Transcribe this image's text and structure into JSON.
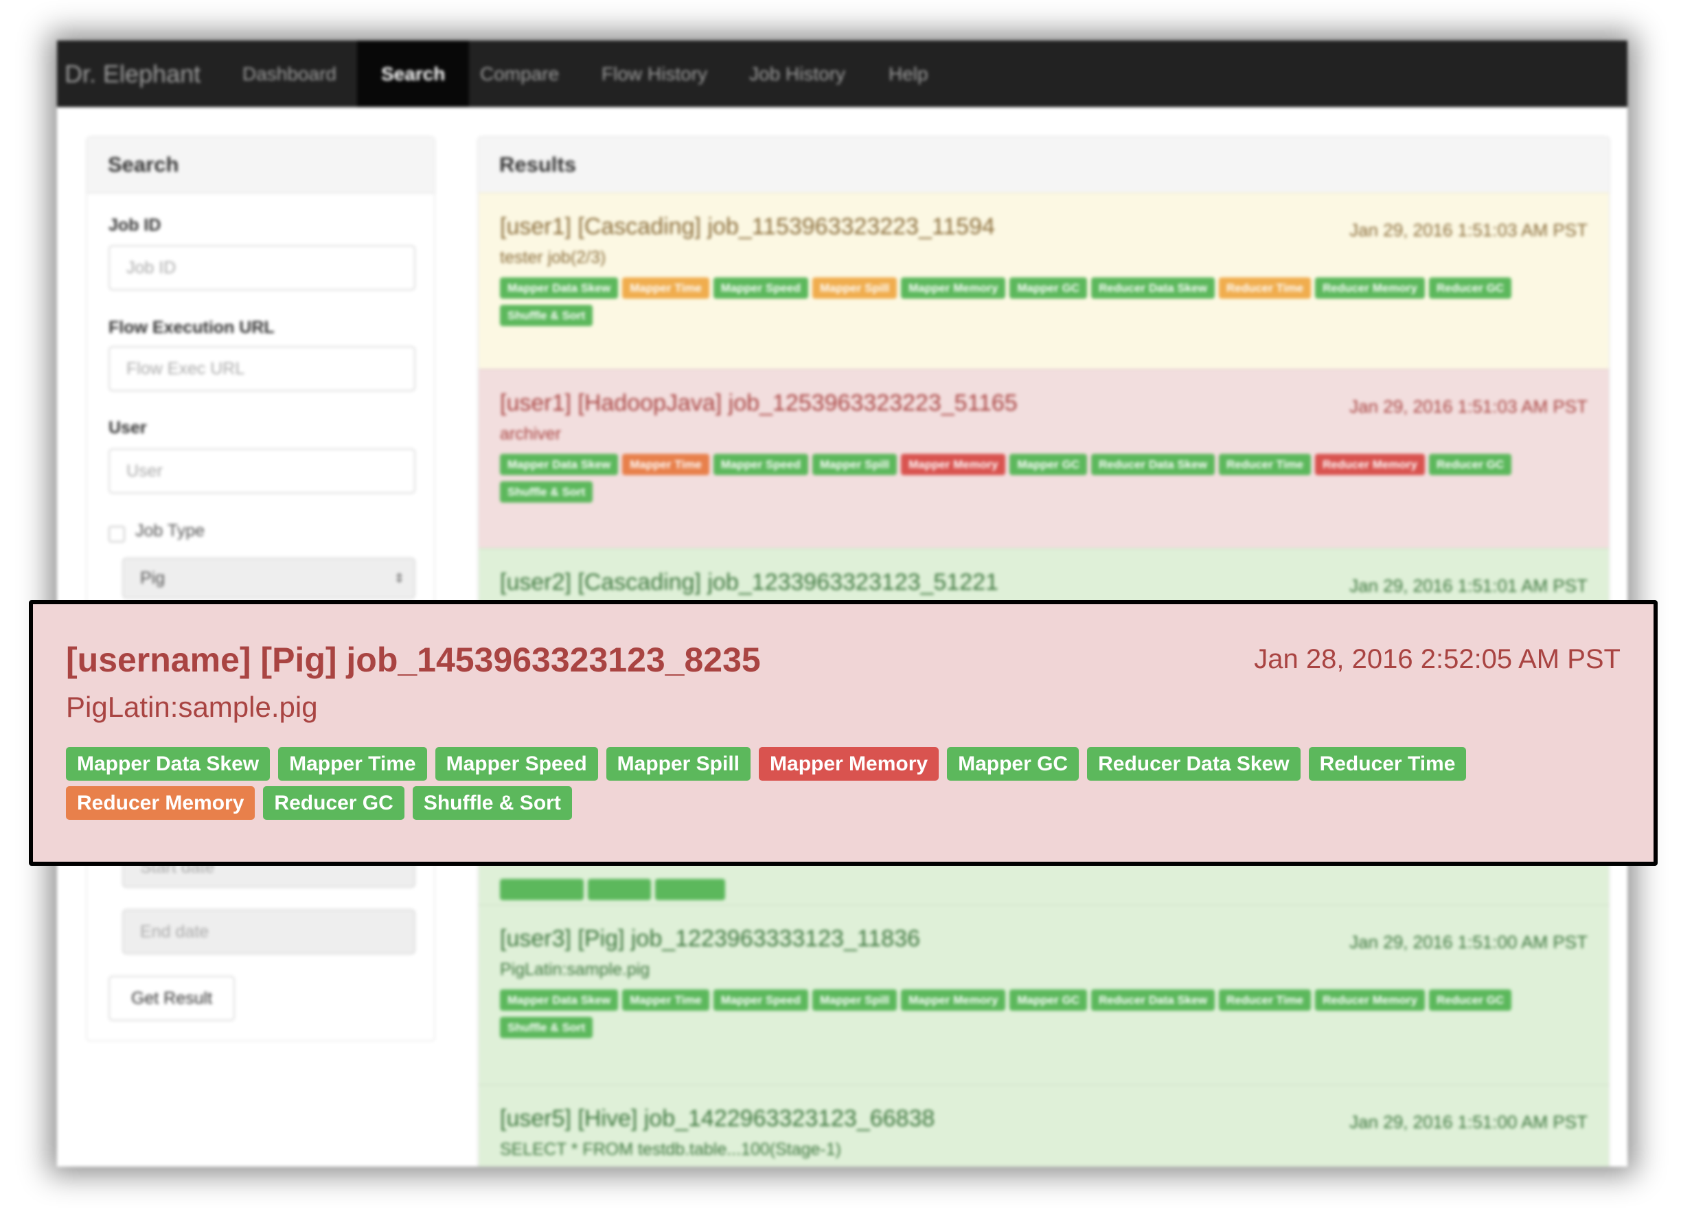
{
  "navbar": {
    "brand": "Dr. Elephant",
    "items": [
      {
        "label": "Dashboard",
        "active": false
      },
      {
        "label": "Search",
        "active": true
      },
      {
        "label": "Compare",
        "active": false
      },
      {
        "label": "Flow History",
        "active": false
      },
      {
        "label": "Job History",
        "active": false
      },
      {
        "label": "Help",
        "active": false
      }
    ]
  },
  "search": {
    "title": "Search",
    "job_id_label": "Job ID",
    "job_id_placeholder": "Job ID",
    "flow_url_label": "Flow Execution URL",
    "flow_url_placeholder": "Flow Exec URL",
    "user_label": "User",
    "user_placeholder": "User",
    "job_type_label": "Job Type",
    "job_type_checked": false,
    "job_type_value": "Pig",
    "start_date_placeholder": "Start date",
    "end_date_placeholder": "End date",
    "submit_label": "Get Result"
  },
  "results": {
    "title": "Results",
    "rows": [
      {
        "severity": "warning",
        "title": "[user1] [Cascading] job_1153963323223_11594",
        "subtitle": "tester job(2/3)",
        "date": "Jan 29, 2016 1:51:03 AM PST",
        "badges": [
          [
            "Mapper Data Skew",
            "green"
          ],
          [
            "Mapper Time",
            "orange"
          ],
          [
            "Mapper Speed",
            "green"
          ],
          [
            "Mapper Spill",
            "orange"
          ],
          [
            "Mapper Memory",
            "green"
          ],
          [
            "Mapper GC",
            "green"
          ],
          [
            "Reducer Data Skew",
            "green"
          ],
          [
            "Reducer Time",
            "orange"
          ],
          [
            "Reducer Memory",
            "green"
          ],
          [
            "Reducer GC",
            "green"
          ],
          [
            "Shuffle & Sort",
            "green"
          ]
        ]
      },
      {
        "severity": "danger",
        "title": "[user1] [HadoopJava] job_1253963323223_51165",
        "subtitle": "archiver",
        "date": "Jan 29, 2016 1:51:03 AM PST",
        "badges": [
          [
            "Mapper Data Skew",
            "green"
          ],
          [
            "Mapper Time",
            "darkorange"
          ],
          [
            "Mapper Speed",
            "green"
          ],
          [
            "Mapper Spill",
            "green"
          ],
          [
            "Mapper Memory",
            "red"
          ],
          [
            "Mapper GC",
            "green"
          ],
          [
            "Reducer Data Skew",
            "green"
          ],
          [
            "Reducer Time",
            "green"
          ],
          [
            "Reducer Memory",
            "red"
          ],
          [
            "Reducer GC",
            "green"
          ],
          [
            "Shuffle & Sort",
            "green"
          ]
        ]
      },
      {
        "severity": "success",
        "title": "[user2] [Cascading] job_1233963323123_51221",
        "subtitle": "",
        "date": "Jan 29, 2016 1:51:01 AM PST",
        "badges": []
      },
      {
        "severity": "success",
        "title": "[user3] [Pig] job_1223963333123_11836",
        "subtitle": "PigLatin:sample.pig",
        "date": "Jan 29, 2016 1:51:00 AM PST",
        "badges": [
          [
            "Mapper Data Skew",
            "green"
          ],
          [
            "Mapper Time",
            "green"
          ],
          [
            "Mapper Speed",
            "green"
          ],
          [
            "Mapper Spill",
            "green"
          ],
          [
            "Mapper Memory",
            "green"
          ],
          [
            "Mapper GC",
            "green"
          ],
          [
            "Reducer Data Skew",
            "green"
          ],
          [
            "Reducer Time",
            "green"
          ],
          [
            "Reducer Memory",
            "green"
          ],
          [
            "Reducer GC",
            "green"
          ],
          [
            "Shuffle & Sort",
            "green"
          ]
        ]
      },
      {
        "severity": "success",
        "title": "[user5] [Hive] job_1422963323123_66838",
        "subtitle": "SELECT * FROM testdb.table...100(Stage-1)",
        "date": "Jan 29, 2016 1:51:00 AM PST",
        "badges": []
      }
    ]
  },
  "highlight": {
    "title": "[username] [Pig] job_1453963323123_8235",
    "subtitle": "PigLatin:sample.pig",
    "date": "Jan 28, 2016 2:52:05 AM PST",
    "badges": [
      [
        "Mapper Data Skew",
        "green"
      ],
      [
        "Mapper Time",
        "green"
      ],
      [
        "Mapper Speed",
        "green"
      ],
      [
        "Mapper Spill",
        "green"
      ],
      [
        "Mapper Memory",
        "red"
      ],
      [
        "Mapper GC",
        "green"
      ],
      [
        "Reducer Data Skew",
        "green"
      ],
      [
        "Reducer Time",
        "green"
      ],
      [
        "Reducer Memory",
        "darkorange"
      ],
      [
        "Reducer GC",
        "green"
      ],
      [
        "Shuffle & Sort",
        "green"
      ]
    ]
  },
  "colors": {
    "warning_bg": "#fcf8e3",
    "warning_text": "#8a6d3b",
    "danger_bg": "#f2dede",
    "danger_text": "#a94442",
    "success_bg": "#dff0d8",
    "success_text": "#3c763d",
    "green": "#5cb85c",
    "orange": "#f0ad4e",
    "red": "#d9534f",
    "darkorange": "#e8804b"
  }
}
